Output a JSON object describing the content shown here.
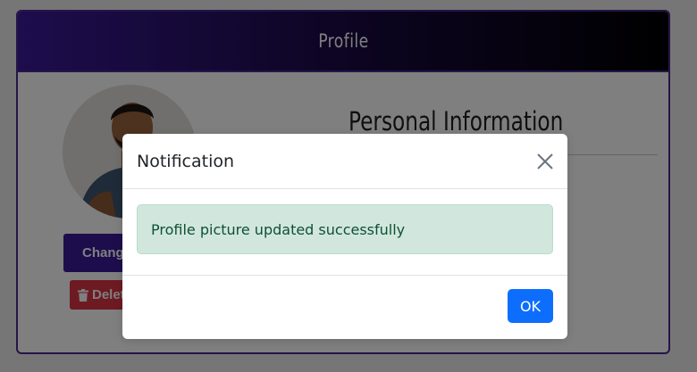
{
  "card": {
    "title": "Profile",
    "section_title": "Personal Information",
    "change_button_label": "Change Picture",
    "delete_button_label": "Delete"
  },
  "icons": {
    "delete": "trash-icon",
    "close": "close-icon"
  },
  "colors": {
    "header_gradient_start": "#3b1a9a",
    "header_gradient_end": "#000000",
    "card_border": "#4b2a91",
    "change_button": "#3b1a9a",
    "delete_button": "#dc3545",
    "alert_bg": "#d1e7dd",
    "alert_text": "#0f5132",
    "ok_button": "#0d6efd"
  },
  "modal": {
    "title": "Notification",
    "message": "Profile picture updated successfully",
    "ok_label": "OK"
  }
}
